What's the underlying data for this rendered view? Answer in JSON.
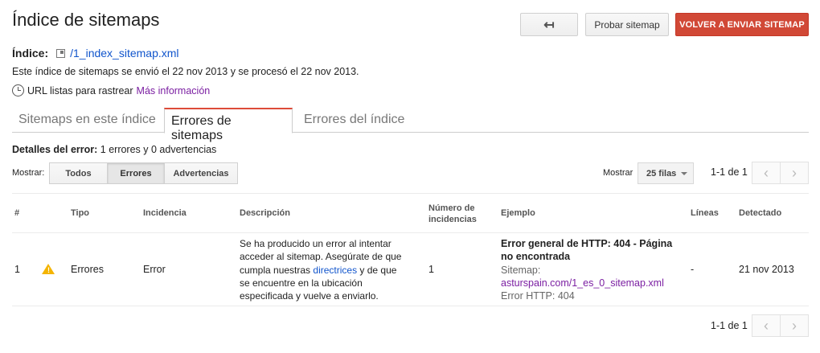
{
  "page": {
    "title": "Índice de sitemaps",
    "back_icon": "↤",
    "test_button": "Probar sitemap",
    "resend_button": "VOLVER A ENVIAR SITEMAP"
  },
  "index": {
    "label": "Índice:",
    "file_link": "/1_index_sitemap.xml",
    "sent_text": "Este índice de sitemaps se envió el 22 nov 2013 y se procesó el 22 nov 2013.",
    "ready_text": "URL listas para rastrear",
    "more_info": "Más información"
  },
  "tabs": [
    {
      "label": "Sitemaps en este índice",
      "active": false
    },
    {
      "label": "Errores de sitemaps",
      "active": true
    },
    {
      "label": "Errores del índice",
      "active": false
    }
  ],
  "details": {
    "label": "Detalles del error:",
    "summary": "1 errores y 0 advertencias"
  },
  "filter": {
    "show_label": "Mostrar:",
    "options": [
      "Todos",
      "Errores",
      "Advertencias"
    ],
    "selected": "Errores"
  },
  "rows_select": {
    "label": "Mostrar",
    "value": "25 filas"
  },
  "pager": {
    "range": "1-1 de 1"
  },
  "table": {
    "headers": {
      "num": "#",
      "tipo": "Tipo",
      "incidencia": "Incidencia",
      "descripcion": "Descripción",
      "numero_line1": "Número de",
      "numero_line2": "incidencias",
      "ejemplo": "Ejemplo",
      "lineas": "Líneas",
      "detectado": "Detectado"
    },
    "rows": [
      {
        "num": "1",
        "tipo": "Errores",
        "incidencia": "Error",
        "desc_line1": "Se ha producido un error al intentar",
        "desc_line2": "acceder al sitemap. Asegúrate de que",
        "desc_line3_pre": "cumpla nuestras ",
        "desc_link": "directrices",
        "desc_line3_post": " y de que",
        "desc_line4": "se encuentre en la ubicación",
        "desc_line5": "especificada y vuelve a enviarlo.",
        "count": "1",
        "example_title_1": "Error general de HTTP: 404 - Página",
        "example_title_2": "no encontrada",
        "example_sitemap_label": "Sitemap:",
        "example_url": "asturspain.com/1_es_0_sitemap.xml",
        "example_http": "Error HTTP: 404",
        "lineas": "-",
        "detectado": "21 nov 2013"
      }
    ]
  }
}
